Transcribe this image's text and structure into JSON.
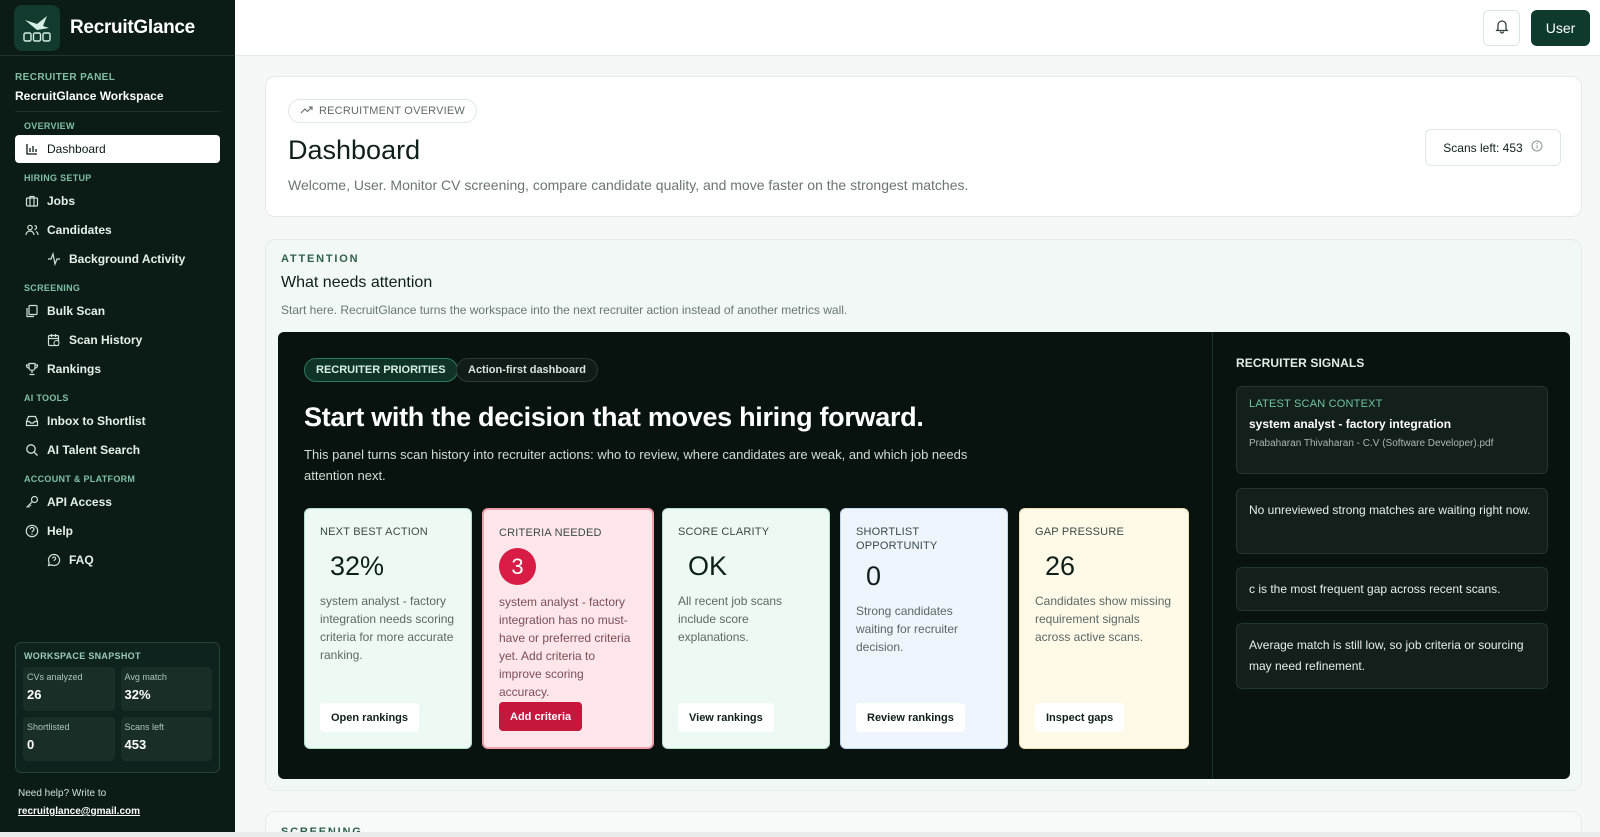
{
  "brand": {
    "name": "RecruitGlance"
  },
  "panel": {
    "label": "RECRUITER PANEL",
    "workspace": "RecruitGlance Workspace"
  },
  "nav": {
    "groups": {
      "overview": "OVERVIEW",
      "hiring": "HIRING SETUP",
      "screening": "SCREENING",
      "ai": "AI TOOLS",
      "account": "ACCOUNT & PLATFORM"
    },
    "items": {
      "dashboard": "Dashboard",
      "jobs": "Jobs",
      "candidates": "Candidates",
      "background": "Background Activity",
      "bulk_scan": "Bulk Scan",
      "scan_history": "Scan History",
      "rankings": "Rankings",
      "inbox": "Inbox to Shortlist",
      "talent_search": "AI Talent Search",
      "api": "API Access",
      "help": "Help",
      "faq": "FAQ"
    }
  },
  "snapshot": {
    "title": "WORKSPACE SNAPSHOT",
    "cells": [
      {
        "label": "CVs analyzed",
        "value": "26"
      },
      {
        "label": "Avg match",
        "value": "32%"
      },
      {
        "label": "Shortlisted",
        "value": "0"
      },
      {
        "label": "Scans left",
        "value": "453"
      }
    ]
  },
  "help": {
    "text": "Need help? Write to",
    "email": "recruitglance@gmail.com"
  },
  "topbar": {
    "user": "User"
  },
  "overview": {
    "pill": "RECRUITMENT OVERVIEW",
    "title": "Dashboard",
    "subtitle": "Welcome, User. Monitor CV screening, compare candidate quality, and move faster on the strongest matches.",
    "scans_left": "Scans left: 453"
  },
  "attention": {
    "label": "ATTENTION",
    "title": "What needs attention",
    "subtitle": "Start here. RecruitGlance turns the workspace into the next recruiter action instead of another metrics wall.",
    "tag1": "RECRUITER PRIORITIES",
    "tag2": "Action-first dashboard",
    "hero": "Start with the decision that moves hiring forward.",
    "hero_sub": "This panel turns scan history into recruiter actions: who to review, where candidates are weak, and which job needs attention next.",
    "cards": [
      {
        "label": "NEXT BEST ACTION",
        "value": "32%",
        "text": "system analyst - factory integration needs scoring criteria for more accurate ranking.",
        "button": "Open rankings"
      },
      {
        "label": "CRITERIA NEEDED",
        "value": "3",
        "text": "system analyst - factory integration has no must-have or preferred criteria yet. Add criteria to improve scoring accuracy.",
        "button": "Add criteria"
      },
      {
        "label": "SCORE CLARITY",
        "value": "OK",
        "text": "All recent job scans include score explanations.",
        "button": "View rankings"
      },
      {
        "label": "SHORTLIST OPPORTUNITY",
        "value": "0",
        "text": "Strong candidates waiting for recruiter decision.",
        "button": "Review rankings"
      },
      {
        "label": "GAP PRESSURE",
        "value": "26",
        "text": "Candidates show missing requirement signals across active scans.",
        "button": "Inspect gaps"
      }
    ]
  },
  "signals": {
    "title": "RECRUITER SIGNALS",
    "context_label": "LATEST SCAN CONTEXT",
    "context_job": "system analyst - factory integration",
    "context_file": "Prabaharan Thivaharan - C.V (Software Developer).pdf",
    "items": [
      "No unreviewed strong matches are waiting right now.",
      "c is the most frequent gap across recent scans.",
      "Average match is still low, so job criteria or sourcing may need refinement."
    ]
  },
  "screening": {
    "label": "SCREENING"
  },
  "colors": {
    "sidebar_bg": "#0b1c17",
    "primary": "#0d3a2c",
    "alert": "#d81c45"
  }
}
